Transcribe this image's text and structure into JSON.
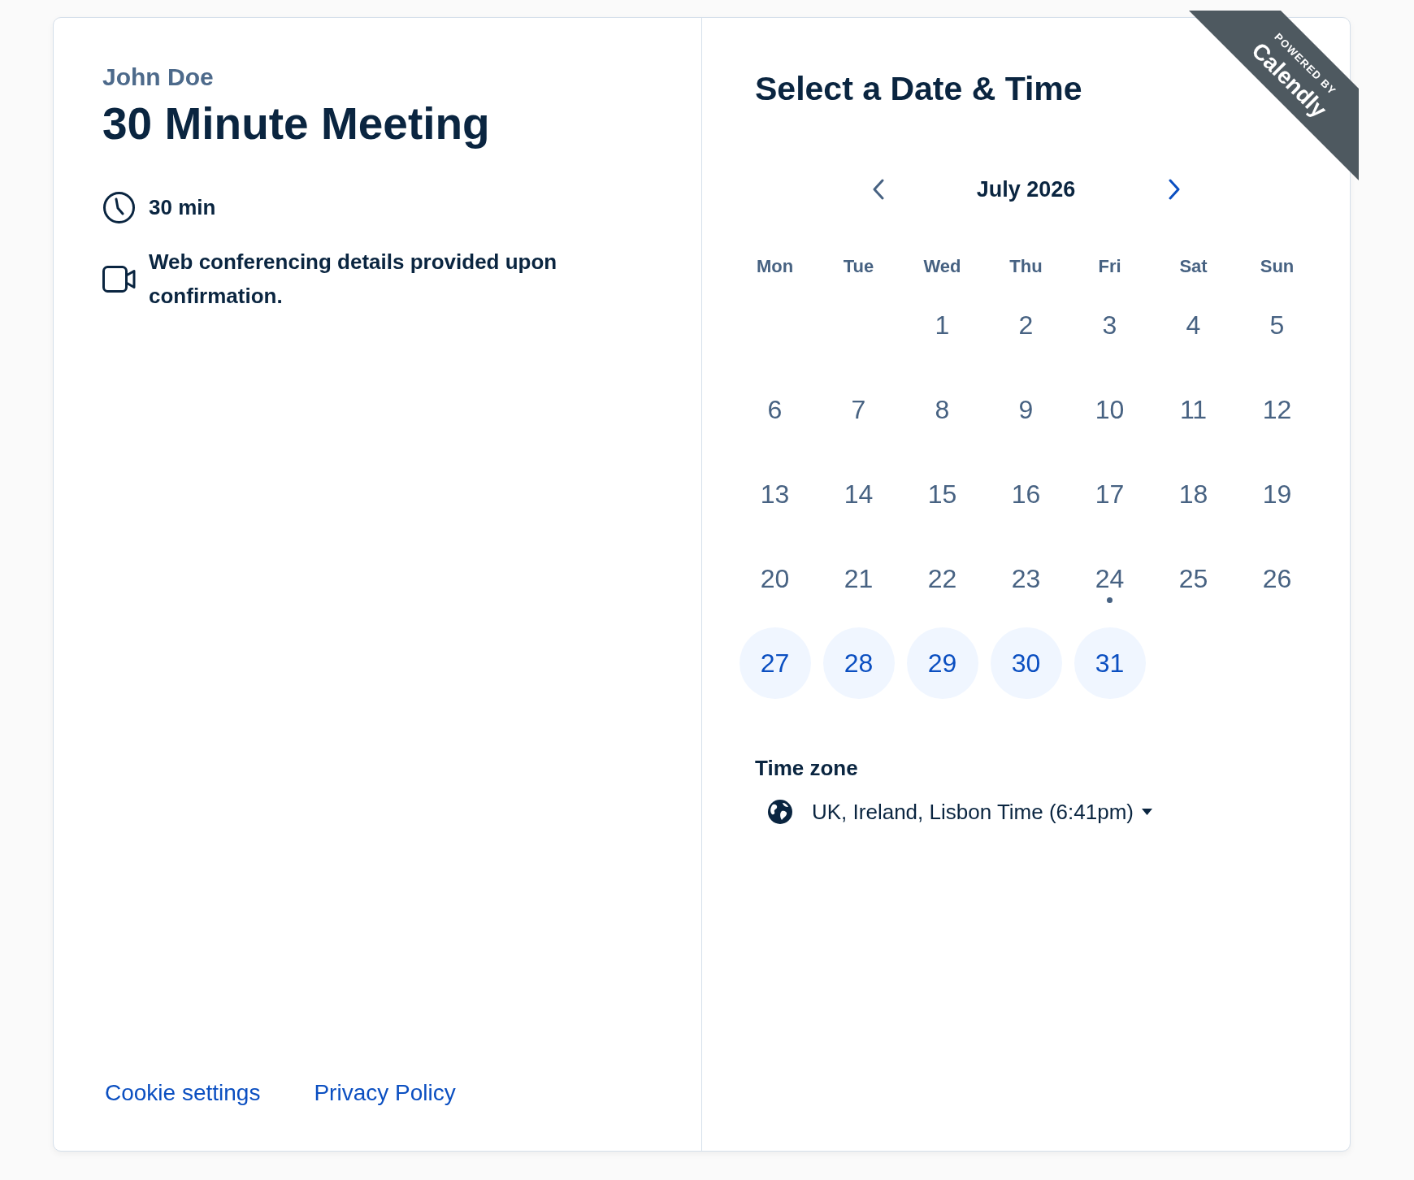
{
  "organizer": "John Doe",
  "event_title": "30 Minute Meeting",
  "details": [
    {
      "kind": "duration",
      "text": "30 min"
    },
    {
      "kind": "video",
      "text": "Web conferencing details provided upon confirmation."
    }
  ],
  "footer_links": [
    "Cookie settings",
    "Privacy Policy"
  ],
  "badge": {
    "caption": "POWERED BY",
    "brand": "Calendly"
  },
  "heading": "Select a Date & Time",
  "calendar": {
    "month": "July 2026",
    "prev_button": {
      "disabled": true
    },
    "next_button": {
      "disabled": false
    },
    "weekdays": [
      "Mon",
      "Tue",
      "Wed",
      "Thu",
      "Fri",
      "Sat",
      "Sun"
    ],
    "weeks": [
      [
        {
          "day": "1",
          "available": false,
          "today": false
        },
        {
          "day": "2",
          "available": false,
          "today": false
        },
        {
          "day": "3",
          "available": false,
          "today": false
        },
        {
          "day": "4",
          "available": false,
          "today": false
        },
        {
          "day": "5",
          "available": false,
          "today": false
        }
      ],
      [
        {
          "day": "6",
          "available": false,
          "today": false
        },
        {
          "day": "7",
          "available": false,
          "today": false
        },
        {
          "day": "8",
          "available": false,
          "today": false
        },
        {
          "day": "9",
          "available": false,
          "today": false
        },
        {
          "day": "10",
          "available": false,
          "today": false
        },
        {
          "day": "11",
          "available": false,
          "today": false
        },
        {
          "day": "12",
          "available": false,
          "today": false
        }
      ],
      [
        {
          "day": "13",
          "available": false,
          "today": false
        },
        {
          "day": "14",
          "available": false,
          "today": false
        },
        {
          "day": "15",
          "available": false,
          "today": false
        },
        {
          "day": "16",
          "available": false,
          "today": false
        },
        {
          "day": "17",
          "available": false,
          "today": false
        },
        {
          "day": "18",
          "available": false,
          "today": false
        },
        {
          "day": "19",
          "available": false,
          "today": false
        }
      ],
      [
        {
          "day": "20",
          "available": false,
          "today": false
        },
        {
          "day": "21",
          "available": false,
          "today": false
        },
        {
          "day": "22",
          "available": false,
          "today": false
        },
        {
          "day": "23",
          "available": false,
          "today": false
        },
        {
          "day": "24",
          "available": false,
          "today": true
        },
        {
          "day": "25",
          "available": false,
          "today": false
        },
        {
          "day": "26",
          "available": false,
          "today": false
        }
      ],
      [
        {
          "day": "27",
          "available": true,
          "today": false
        },
        {
          "day": "28",
          "available": true,
          "today": false
        },
        {
          "day": "29",
          "available": true,
          "today": false
        },
        {
          "day": "30",
          "available": true,
          "today": false
        },
        {
          "day": "31",
          "available": true,
          "today": false
        }
      ]
    ]
  },
  "time_zone": {
    "label": "Time zone",
    "value": "UK, Ireland, Lisbon Time (6:41pm)"
  }
}
